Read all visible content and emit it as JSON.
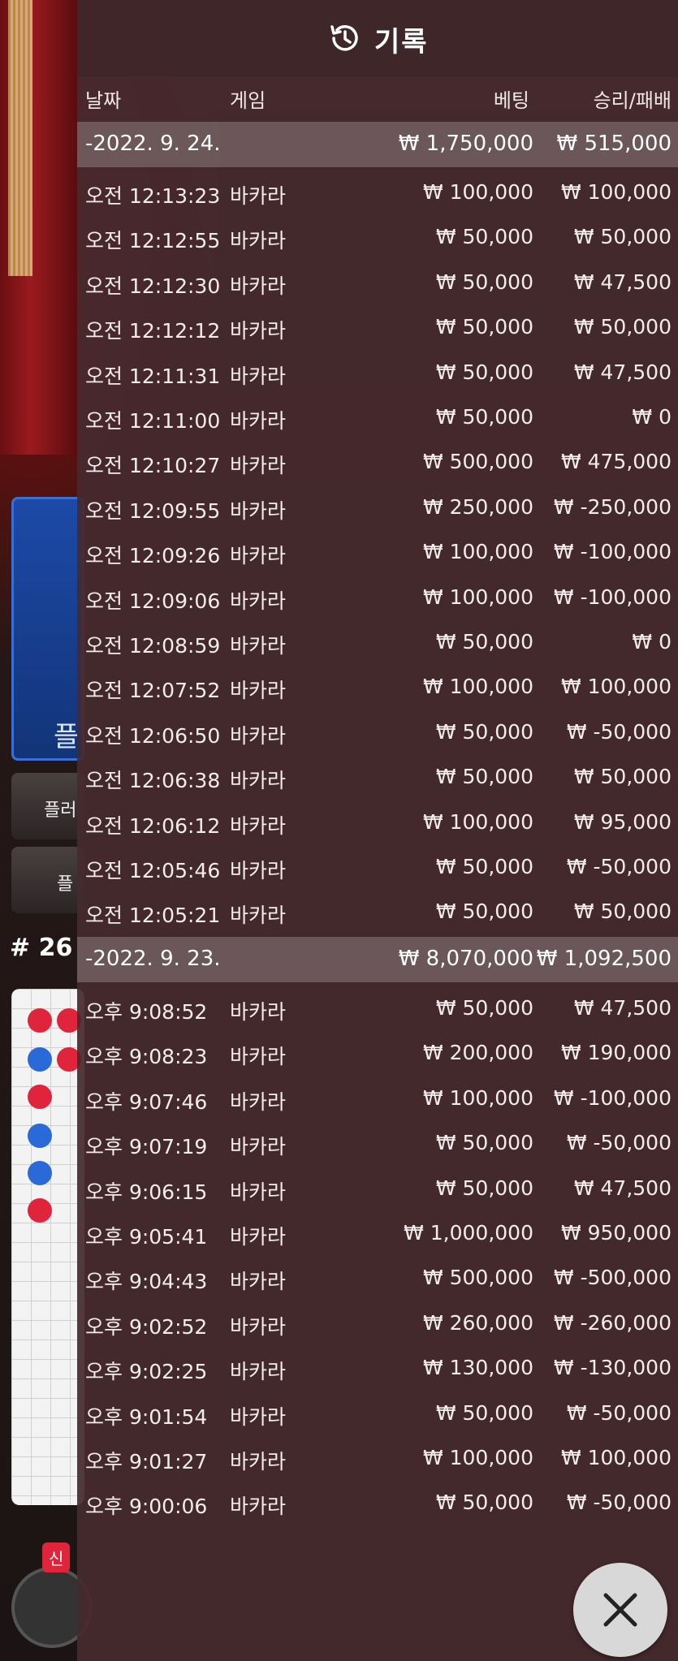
{
  "header": {
    "title": "기록"
  },
  "columns": {
    "date": "날짜",
    "game": "게임",
    "bet": "베팅",
    "result": "승리/패배"
  },
  "background": {
    "blue_label": "플",
    "btn1_label": "플러",
    "btn2_label": "플",
    "round_number": "# 26",
    "new_badge": "신"
  },
  "groups": [
    {
      "date": "-2022. 9. 24.",
      "bet_total": "₩ 1,750,000",
      "result_total": "₩ 515,000",
      "rows": [
        {
          "time": "오전 12:13:23",
          "game": "바카라",
          "bet": "₩ 100,000",
          "result": "₩ 100,000"
        },
        {
          "time": "오전 12:12:55",
          "game": "바카라",
          "bet": "₩ 50,000",
          "result": "₩ 50,000"
        },
        {
          "time": "오전 12:12:30",
          "game": "바카라",
          "bet": "₩ 50,000",
          "result": "₩ 47,500"
        },
        {
          "time": "오전 12:12:12",
          "game": "바카라",
          "bet": "₩ 50,000",
          "result": "₩ 50,000"
        },
        {
          "time": "오전 12:11:31",
          "game": "바카라",
          "bet": "₩ 50,000",
          "result": "₩ 47,500"
        },
        {
          "time": "오전 12:11:00",
          "game": "바카라",
          "bet": "₩ 50,000",
          "result": "₩ 0"
        },
        {
          "time": "오전 12:10:27",
          "game": "바카라",
          "bet": "₩ 500,000",
          "result": "₩ 475,000"
        },
        {
          "time": "오전 12:09:55",
          "game": "바카라",
          "bet": "₩ 250,000",
          "result": "₩ -250,000"
        },
        {
          "time": "오전 12:09:26",
          "game": "바카라",
          "bet": "₩ 100,000",
          "result": "₩ -100,000"
        },
        {
          "time": "오전 12:09:06",
          "game": "바카라",
          "bet": "₩ 100,000",
          "result": "₩ -100,000"
        },
        {
          "time": "오전 12:08:59",
          "game": "바카라",
          "bet": "₩ 50,000",
          "result": "₩ 0"
        },
        {
          "time": "오전 12:07:52",
          "game": "바카라",
          "bet": "₩ 100,000",
          "result": "₩ 100,000"
        },
        {
          "time": "오전 12:06:50",
          "game": "바카라",
          "bet": "₩ 50,000",
          "result": "₩ -50,000"
        },
        {
          "time": "오전 12:06:38",
          "game": "바카라",
          "bet": "₩ 50,000",
          "result": "₩ 50,000"
        },
        {
          "time": "오전 12:06:12",
          "game": "바카라",
          "bet": "₩ 100,000",
          "result": "₩ 95,000"
        },
        {
          "time": "오전 12:05:46",
          "game": "바카라",
          "bet": "₩ 50,000",
          "result": "₩ -50,000"
        },
        {
          "time": "오전 12:05:21",
          "game": "바카라",
          "bet": "₩ 50,000",
          "result": "₩ 50,000"
        }
      ]
    },
    {
      "date": "-2022. 9. 23.",
      "bet_total": "₩ 8,070,000",
      "result_total": "₩ 1,092,500",
      "rows": [
        {
          "time": "오후 9:08:52",
          "game": "바카라",
          "bet": "₩ 50,000",
          "result": "₩ 47,500"
        },
        {
          "time": "오후 9:08:23",
          "game": "바카라",
          "bet": "₩ 200,000",
          "result": "₩ 190,000"
        },
        {
          "time": "오후 9:07:46",
          "game": "바카라",
          "bet": "₩ 100,000",
          "result": "₩ -100,000"
        },
        {
          "time": "오후 9:07:19",
          "game": "바카라",
          "bet": "₩ 50,000",
          "result": "₩ -50,000"
        },
        {
          "time": "오후 9:06:15",
          "game": "바카라",
          "bet": "₩ 50,000",
          "result": "₩ 47,500"
        },
        {
          "time": "오후 9:05:41",
          "game": "바카라",
          "bet": "₩ 1,000,000",
          "result": "₩ 950,000"
        },
        {
          "time": "오후 9:04:43",
          "game": "바카라",
          "bet": "₩ 500,000",
          "result": "₩ -500,000"
        },
        {
          "time": "오후 9:02:52",
          "game": "바카라",
          "bet": "₩ 260,000",
          "result": "₩ -260,000"
        },
        {
          "time": "오후 9:02:25",
          "game": "바카라",
          "bet": "₩ 130,000",
          "result": "₩ -130,000"
        },
        {
          "time": "오후 9:01:54",
          "game": "바카라",
          "bet": "₩ 50,000",
          "result": "₩ -50,000"
        },
        {
          "time": "오후 9:01:27",
          "game": "바카라",
          "bet": "₩ 100,000",
          "result": "₩ 100,000"
        },
        {
          "time": "오후 9:00:06",
          "game": "바카라",
          "bet": "₩ 50,000",
          "result": "₩ -50,000"
        }
      ]
    }
  ],
  "icons": {
    "header": "history-icon",
    "close": "close-icon"
  }
}
